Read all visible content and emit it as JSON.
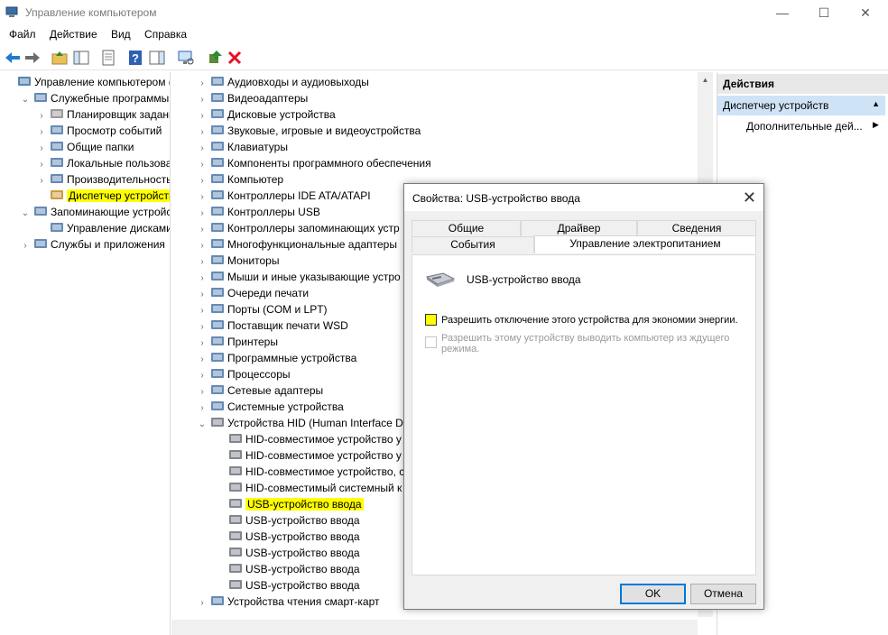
{
  "window": {
    "title": "Управление компьютером"
  },
  "menu": {
    "file": "Файл",
    "action": "Действие",
    "view": "Вид",
    "help": "Справка"
  },
  "left_tree": [
    {
      "label": "Управление компьютером (л",
      "indent": 0,
      "chevron": "",
      "icon": "computer-management-icon"
    },
    {
      "label": "Служебные программы",
      "indent": 1,
      "chevron": "⌄",
      "icon": "tools-icon"
    },
    {
      "label": "Планировщик заданий",
      "indent": 2,
      "chevron": "›",
      "icon": "clock-icon"
    },
    {
      "label": "Просмотр событий",
      "indent": 2,
      "chevron": "›",
      "icon": "event-viewer-icon"
    },
    {
      "label": "Общие папки",
      "indent": 2,
      "chevron": "›",
      "icon": "shared-folder-icon"
    },
    {
      "label": "Локальные пользовате",
      "indent": 2,
      "chevron": "›",
      "icon": "users-icon"
    },
    {
      "label": "Производительность",
      "indent": 2,
      "chevron": "›",
      "icon": "performance-icon"
    },
    {
      "label": "Диспетчер устройств",
      "indent": 2,
      "chevron": "",
      "icon": "device-manager-icon",
      "highlight": true
    },
    {
      "label": "Запоминающие устройст",
      "indent": 1,
      "chevron": "⌄",
      "icon": "storage-icon"
    },
    {
      "label": "Управление дисками",
      "indent": 2,
      "chevron": "",
      "icon": "disk-management-icon"
    },
    {
      "label": "Службы и приложения",
      "indent": 1,
      "chevron": "›",
      "icon": "services-icon"
    }
  ],
  "device_tree": [
    {
      "label": "Аудиовходы и аудиовыходы",
      "indent": 0,
      "chevron": "›",
      "icon": "audio-icon"
    },
    {
      "label": "Видеоадаптеры",
      "indent": 0,
      "chevron": "›",
      "icon": "display-adapter-icon"
    },
    {
      "label": "Дисковые устройства",
      "indent": 0,
      "chevron": "›",
      "icon": "disk-drive-icon"
    },
    {
      "label": "Звуковые, игровые и видеоустройства",
      "indent": 0,
      "chevron": "›",
      "icon": "sound-icon"
    },
    {
      "label": "Клавиатуры",
      "indent": 0,
      "chevron": "›",
      "icon": "keyboard-icon"
    },
    {
      "label": "Компоненты программного обеспечения",
      "indent": 0,
      "chevron": "›",
      "icon": "software-component-icon"
    },
    {
      "label": "Компьютер",
      "indent": 0,
      "chevron": "›",
      "icon": "computer-icon"
    },
    {
      "label": "Контроллеры IDE ATA/ATAPI",
      "indent": 0,
      "chevron": "›",
      "icon": "ide-controller-icon"
    },
    {
      "label": "Контроллеры USB",
      "indent": 0,
      "chevron": "›",
      "icon": "usb-icon"
    },
    {
      "label": "Контроллеры запоминающих устр",
      "indent": 0,
      "chevron": "›",
      "icon": "storage-controller-icon"
    },
    {
      "label": "Многофункциональные адаптеры",
      "indent": 0,
      "chevron": "›",
      "icon": "multifunction-adapter-icon"
    },
    {
      "label": "Мониторы",
      "indent": 0,
      "chevron": "›",
      "icon": "monitor-icon"
    },
    {
      "label": "Мыши и иные указывающие устро",
      "indent": 0,
      "chevron": "›",
      "icon": "mouse-icon"
    },
    {
      "label": "Очереди печати",
      "indent": 0,
      "chevron": "›",
      "icon": "print-queue-icon"
    },
    {
      "label": "Порты (COM и LPT)",
      "indent": 0,
      "chevron": "›",
      "icon": "port-icon"
    },
    {
      "label": "Поставщик печати WSD",
      "indent": 0,
      "chevron": "›",
      "icon": "wsd-printer-icon"
    },
    {
      "label": "Принтеры",
      "indent": 0,
      "chevron": "›",
      "icon": "printer-icon"
    },
    {
      "label": "Программные устройства",
      "indent": 0,
      "chevron": "›",
      "icon": "software-device-icon"
    },
    {
      "label": "Процессоры",
      "indent": 0,
      "chevron": "›",
      "icon": "processor-icon"
    },
    {
      "label": "Сетевые адаптеры",
      "indent": 0,
      "chevron": "›",
      "icon": "network-adapter-icon"
    },
    {
      "label": "Системные устройства",
      "indent": 0,
      "chevron": "›",
      "icon": "system-device-icon"
    },
    {
      "label": "Устройства HID (Human Interface D",
      "indent": 0,
      "chevron": "⌄",
      "icon": "hid-icon"
    },
    {
      "label": "HID-совместимое устройство у",
      "indent": 1,
      "chevron": "",
      "icon": "hid-device-icon"
    },
    {
      "label": "HID-совместимое устройство у",
      "indent": 1,
      "chevron": "",
      "icon": "hid-device-icon"
    },
    {
      "label": "HID-совместимое устройство, с",
      "indent": 1,
      "chevron": "",
      "icon": "hid-device-icon"
    },
    {
      "label": "HID-совместимый системный к",
      "indent": 1,
      "chevron": "",
      "icon": "hid-device-icon"
    },
    {
      "label": "USB-устройство ввода",
      "indent": 1,
      "chevron": "",
      "icon": "hid-device-icon",
      "highlight": true
    },
    {
      "label": "USB-устройство ввода",
      "indent": 1,
      "chevron": "",
      "icon": "hid-device-icon"
    },
    {
      "label": "USB-устройство ввода",
      "indent": 1,
      "chevron": "",
      "icon": "hid-device-icon"
    },
    {
      "label": "USB-устройство ввода",
      "indent": 1,
      "chevron": "",
      "icon": "hid-device-icon"
    },
    {
      "label": "USB-устройство ввода",
      "indent": 1,
      "chevron": "",
      "icon": "hid-device-icon"
    },
    {
      "label": "USB-устройство ввода",
      "indent": 1,
      "chevron": "",
      "icon": "hid-device-icon"
    },
    {
      "label": "Устройства чтения смарт-карт",
      "indent": 0,
      "chevron": "›",
      "icon": "smart-card-reader-icon"
    }
  ],
  "actions": {
    "header": "Действия",
    "section": "Диспетчер устройств",
    "more": "Дополнительные дей..."
  },
  "dialog": {
    "title": "Свойства: USB-устройство ввода",
    "tabs_row1": [
      "Общие",
      "Драйвер",
      "Сведения"
    ],
    "tabs_row2": [
      "События",
      "Управление электропитанием"
    ],
    "device_name": "USB-устройство ввода",
    "option1": "Разрешить отключение этого устройства для экономии энергии.",
    "option2": "Разрешить этому устройству выводить компьютер из ждущего режима.",
    "ok": "OK",
    "cancel": "Отмена"
  },
  "colors": {
    "highlight": "#ffff00",
    "selection": "#cfe3f7",
    "accent": "#0078d7",
    "close_red": "#e81123"
  }
}
